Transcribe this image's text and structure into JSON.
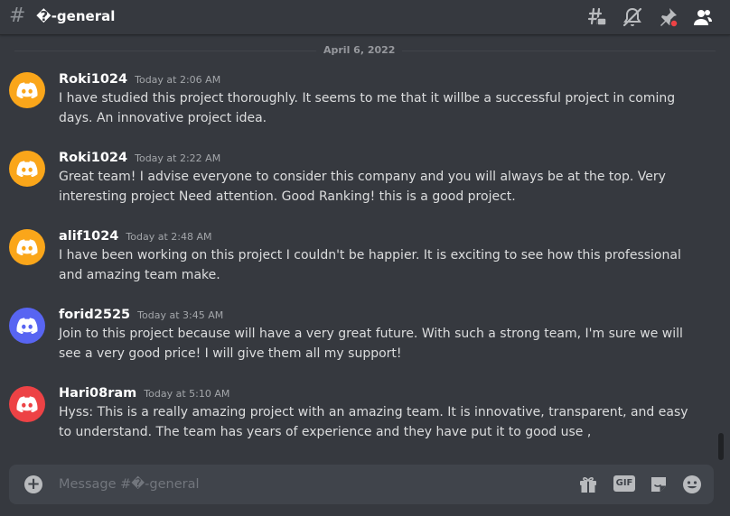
{
  "header": {
    "channel_prefix": "#",
    "channel_name": "�-general",
    "icons": [
      "threads-icon",
      "mute-notifications-icon",
      "pinned-messages-icon",
      "member-list-icon"
    ]
  },
  "date_divider": "April 6, 2022",
  "messages": [
    {
      "username": "Roki1024",
      "timestamp": "Today at 2:06 AM",
      "text": "I have studied this project thoroughly. It seems to me that it willbe a successful project in coming days. An innovative project idea.",
      "avatar_color": "#faa61a"
    },
    {
      "username": "Roki1024",
      "timestamp": "Today at 2:22 AM",
      "text": "Great team! I advise everyone to consider this company and you will always be at the top. Very interesting project Need attention. Good Ranking! this is a good project.",
      "avatar_color": "#faa61a"
    },
    {
      "username": "alif1024",
      "timestamp": "Today at 2:48 AM",
      "text": "I have been working on this project I couldn't be happier. It is exciting to see how this professional and amazing team make.",
      "avatar_color": "#faa61a"
    },
    {
      "username": "forid2525",
      "timestamp": "Today at 3:45 AM",
      "text": "Join to this project because will have a very great future. With such a strong team, I'm sure we will see a very good price! I will give them all my support!",
      "avatar_color": "#5865f2"
    },
    {
      "username": "Hari08ram",
      "timestamp": "Today at 5:10 AM",
      "text": "Hyss: This is a really amazing project with an amazing team. It is innovative, transparent, and easy to understand. The team has years of experience and they have put it to good use ,",
      "avatar_color": "#ed4245"
    }
  ],
  "composer": {
    "placeholder": "Message #�-general",
    "gif_label": "GIF",
    "icons": [
      "add-attachment-icon",
      "gift-icon",
      "gif-icon",
      "sticker-icon",
      "emoji-icon"
    ]
  },
  "colors": {
    "background": "#36393f",
    "input": "#40444b",
    "notification_dot": "#ed4245"
  }
}
